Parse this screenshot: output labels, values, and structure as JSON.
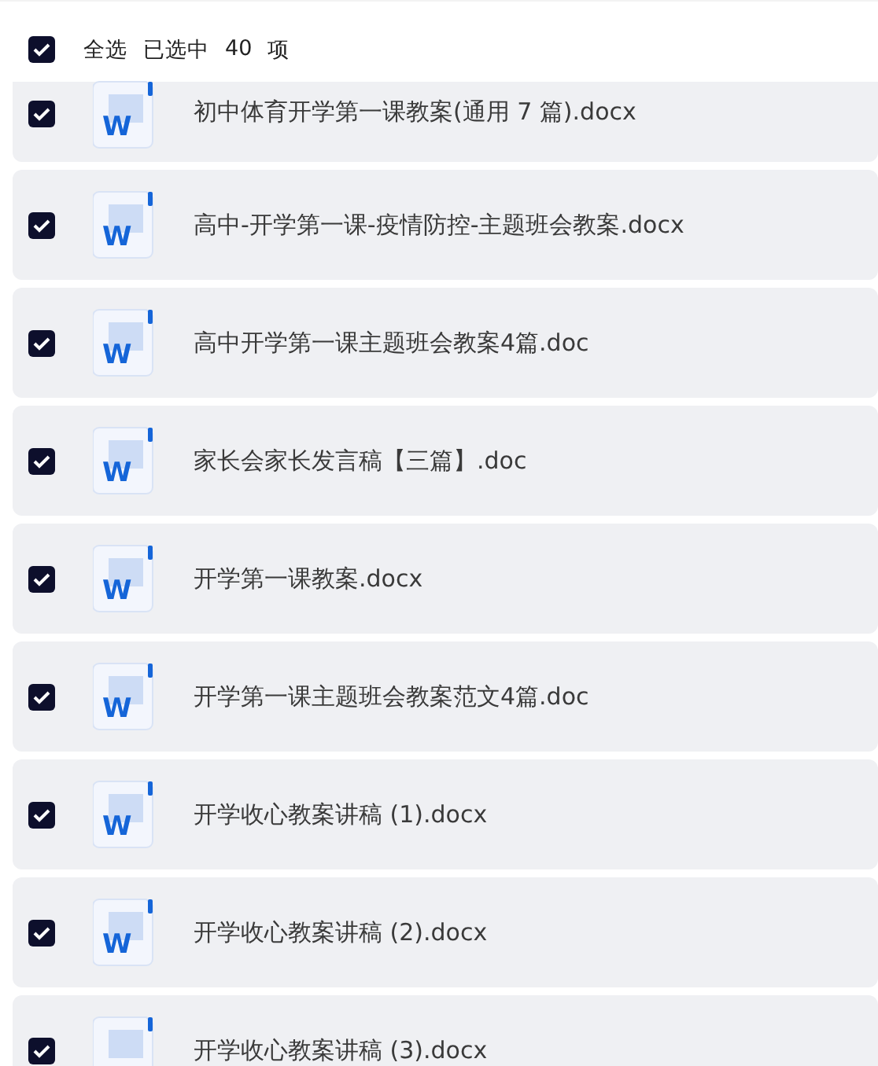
{
  "header": {
    "checked": true,
    "select_all": "全选",
    "selected_label": "已选中",
    "selected_count": "40",
    "unit": "项"
  },
  "files": [
    {
      "name": "初中体育开学第一课教案(通用 7 篇).docx",
      "badge": "W",
      "checked": true
    },
    {
      "name": "高中-开学第一课-疫情防控-主题班会教案.docx",
      "badge": "W",
      "checked": true
    },
    {
      "name": "高中开学第一课主题班会教案4篇.doc",
      "badge": "W",
      "checked": true
    },
    {
      "name": "家长会家长发言稿【三篇】.doc",
      "badge": "W",
      "checked": true
    },
    {
      "name": "开学第一课教案.docx",
      "badge": "W",
      "checked": true
    },
    {
      "name": "开学第一课主题班会教案范文4篇.doc",
      "badge": "W",
      "checked": true
    },
    {
      "name": "开学收心教案讲稿 (1).docx",
      "badge": "W",
      "checked": true
    },
    {
      "name": "开学收心教案讲稿 (2).docx",
      "badge": "W",
      "checked": true
    },
    {
      "name": "开学收心教案讲稿 (3).docx",
      "checked": true
    }
  ]
}
